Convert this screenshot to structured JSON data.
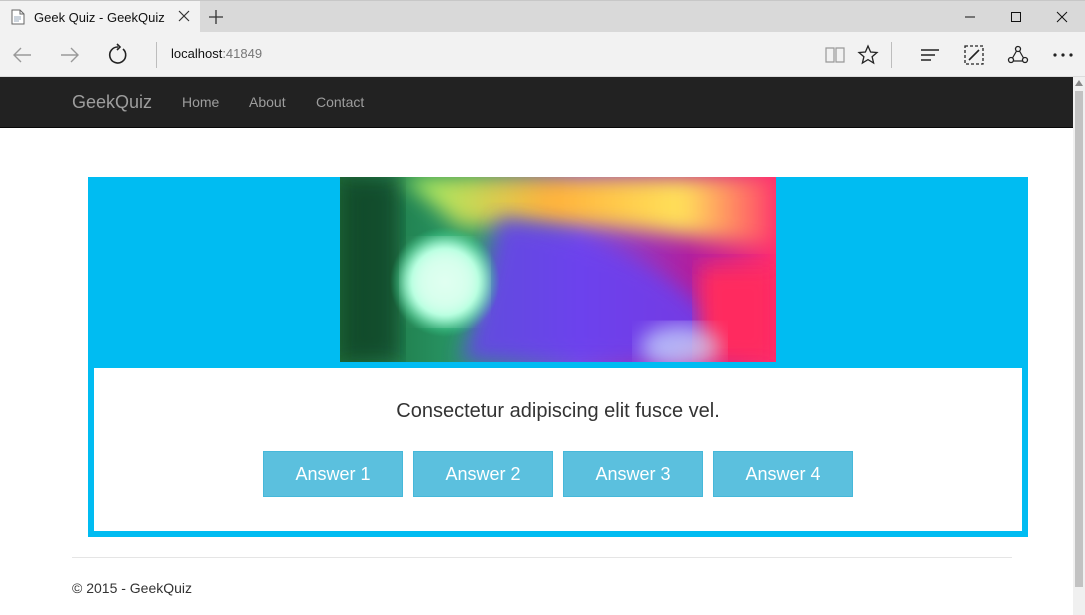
{
  "browser": {
    "tab_title": "Geek Quiz - GeekQuiz",
    "url_host": "localhost",
    "url_port": ":41849",
    "icons": [
      "page-favicon-icon",
      "close-icon",
      "plus-icon",
      "minimize-icon",
      "maximize-icon",
      "close-window-icon",
      "back-icon",
      "forward-icon",
      "refresh-icon",
      "reading-view-icon",
      "favorite-star-icon",
      "hub-icon",
      "web-note-icon",
      "share-icon",
      "more-icon"
    ]
  },
  "site": {
    "brand": "GeekQuiz",
    "nav": {
      "home": "Home",
      "about": "About",
      "contact": "Contact"
    },
    "accent_color": "#00bcf2",
    "button_color": "#5bc0de"
  },
  "quiz": {
    "question": "Consectetur adipiscing elit fusce vel.",
    "answers": [
      "Answer 1",
      "Answer 2",
      "Answer 3",
      "Answer 4"
    ]
  },
  "footer": {
    "text": "© 2015 - GeekQuiz"
  }
}
